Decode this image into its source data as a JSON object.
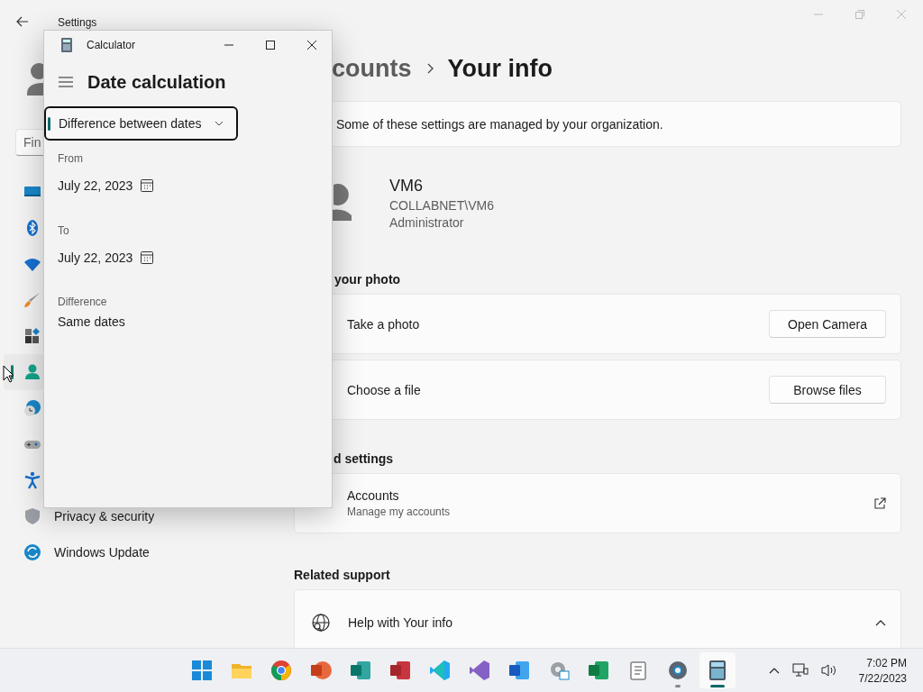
{
  "settings": {
    "title": "Settings",
    "search": {
      "placeholder": "Fin"
    },
    "nav": [
      {
        "selected": false
      },
      {
        "selected": false
      },
      {
        "selected": false
      },
      {
        "selected": false
      },
      {
        "selected": false
      },
      {
        "selected": true
      },
      {
        "selected": false
      },
      {
        "selected": false
      },
      {
        "selected": false
      },
      {
        "selected": false,
        "label": "Privacy & security"
      },
      {
        "selected": false,
        "label": "Windows Update"
      }
    ],
    "breadcrumb": {
      "parent": "counts",
      "current": "Your info"
    },
    "notice": "Some of these settings are managed by your organization.",
    "profile": {
      "name": "VM6",
      "account": "COLLABNET\\VM6",
      "role": "Administrator"
    },
    "sections": [
      {
        "heading": "your photo",
        "cards": [
          {
            "kind": "action",
            "label": "Take a photo",
            "button": "Open Camera"
          },
          {
            "kind": "action",
            "label": "Choose a file",
            "button": "Browse files"
          }
        ]
      },
      {
        "heading": "d settings",
        "cards": [
          {
            "kind": "link",
            "label": "Accounts",
            "sublabel": "Manage my accounts"
          }
        ]
      },
      {
        "heading": "Related support",
        "cards": [
          {
            "kind": "expander",
            "label": "Help with Your info",
            "expanded": true
          }
        ]
      }
    ]
  },
  "calculator": {
    "title": "Calculator",
    "mode": "Date calculation",
    "dropdown": "Difference between dates",
    "fields": [
      {
        "label": "From",
        "value": "July 22, 2023"
      },
      {
        "label": "To",
        "value": "July 22, 2023"
      }
    ],
    "result": {
      "label": "Difference",
      "value": "Same dates"
    }
  },
  "taskbar": {
    "apps": [
      {
        "running": false,
        "selected": false
      },
      {
        "running": false,
        "selected": false
      },
      {
        "running": false,
        "selected": false
      },
      {
        "running": false,
        "selected": false
      },
      {
        "running": false,
        "selected": false
      },
      {
        "running": false,
        "selected": false
      },
      {
        "running": false,
        "selected": false
      },
      {
        "running": false,
        "selected": false
      },
      {
        "running": false,
        "selected": false
      },
      {
        "running": false,
        "selected": false
      },
      {
        "running": false,
        "selected": false
      },
      {
        "running": false,
        "selected": false
      },
      {
        "running": true,
        "selected": false
      },
      {
        "running": true,
        "selected": true
      }
    ],
    "time": "7:02 PM",
    "date": "7/22/2023"
  }
}
